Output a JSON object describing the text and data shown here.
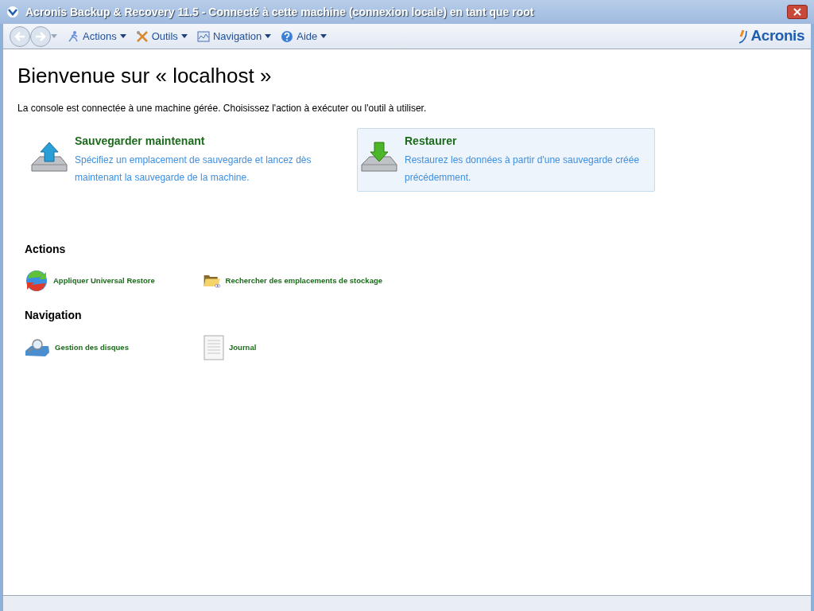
{
  "window": {
    "title": "Acronis Backup & Recovery 11.5 - Connecté à cette machine (connexion locale) en tant que root"
  },
  "toolbar": {
    "menus": [
      {
        "label": "Actions",
        "kind": "actions"
      },
      {
        "label": "Outils",
        "kind": "tools"
      },
      {
        "label": "Navigation",
        "kind": "navigation"
      },
      {
        "label": "Aide",
        "kind": "help"
      }
    ],
    "logo": "Acronis"
  },
  "heading": "Bienvenue sur « localhost »",
  "intro": "La console est connectée à une machine gérée. Choisissez l'action à exécuter ou l'outil à utiliser.",
  "tasks": [
    {
      "title": "Sauvegarder maintenant",
      "description": "Spécifiez un emplacement de sauvegarde et lancez dès maintenant la sauvegarde de la machine.",
      "kind": "backup",
      "highlighted": false
    },
    {
      "title": "Restaurer",
      "description": "Restaurez les données à partir d'une sauvegarde créée précédemment.",
      "kind": "restore",
      "highlighted": true
    }
  ],
  "sections": [
    {
      "title": "Actions",
      "items": [
        {
          "label": "Appliquer Universal Restore",
          "kind": "universal"
        },
        {
          "label": "Rechercher des emplacements de stockage",
          "kind": "folder"
        }
      ]
    },
    {
      "title": "Navigation",
      "items": [
        {
          "label": "Gestion des disques",
          "kind": "disk"
        },
        {
          "label": "Journal",
          "kind": "log"
        }
      ]
    }
  ]
}
